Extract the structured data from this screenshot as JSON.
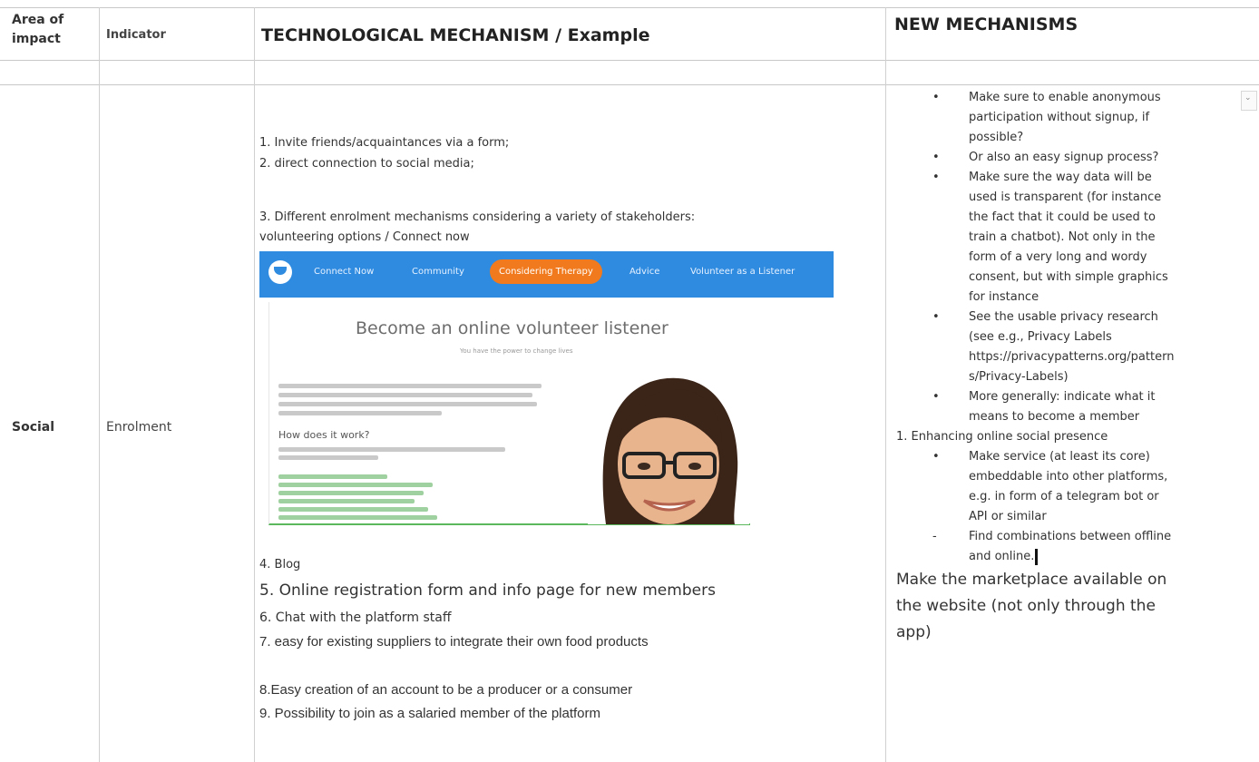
{
  "table": {
    "headers": {
      "area_of_impact": [
        "Area of",
        "impact"
      ],
      "indicator": "Indicator",
      "technological_mechanism": "TECHNOLOGICAL MECHANISM / Example",
      "new_mechanisms": "NEW MECHANISMS"
    },
    "row": {
      "area": "Social",
      "indicator": "Enrolment",
      "tech_items_top": [
        "1. Invite friends/acquaintances via a form;",
        "2. direct connection to social media;",
        "3. Different enrolment mechanisms considering a variety of stakeholders:",
        "volunteering options / Connect now"
      ],
      "tech_items_bottom": [
        "4. Blog",
        "5. Online registration form and info page for new members",
        "6. Chat with the platform staff",
        "7. easy for existing suppliers to integrate their own food products",
        "8.Easy creation of an account to be a producer or a consumer",
        "9. Possibility to join as a salaried member of the platform"
      ],
      "new_mechanisms": {
        "bullets": [
          [
            "Make sure to enable anonymous",
            "participation without signup, if",
            "possible?"
          ],
          [
            "Or also an easy signup process?"
          ],
          [
            "Make sure the way data will be",
            "used is transparent (for instance",
            "the fact that it could be used to",
            "train a chatbot). Not only in the",
            "form of a very long and wordy",
            "consent, but with simple graphics",
            "for instance"
          ],
          [
            "See the usable privacy research",
            "(see e.g., Privacy Labels",
            "https://privacypatterns.org/pattern",
            "s/Privacy-Labels)"
          ],
          [
            "More generally: indicate what it",
            "means to become a member"
          ]
        ],
        "numbered_heading": "1. Enhancing online social presence",
        "sub_bullets": [
          [
            "Make service (at least its core)",
            "embeddable into other platforms,",
            "e.g. in form of a telegram bot or",
            "API or similar"
          ]
        ],
        "dash_item": [
          "Find combinations between offline",
          "and online."
        ],
        "closing": [
          "Make the marketplace available on",
          "the website (not only through the",
          "app)"
        ]
      }
    }
  },
  "embedded_screenshot": {
    "nav_items": [
      "Connect Now",
      "Community",
      "Considering Therapy",
      "Advice",
      "Volunteer as a Listener"
    ],
    "title": "Become an online volunteer listener",
    "subtitle": "You have the power to change lives",
    "section_heading": "How does it work?"
  },
  "colors": {
    "nav_blue": "#2f8be0",
    "nav_pill_orange": "#f07a1d",
    "accent_green": "#5cb85c"
  }
}
